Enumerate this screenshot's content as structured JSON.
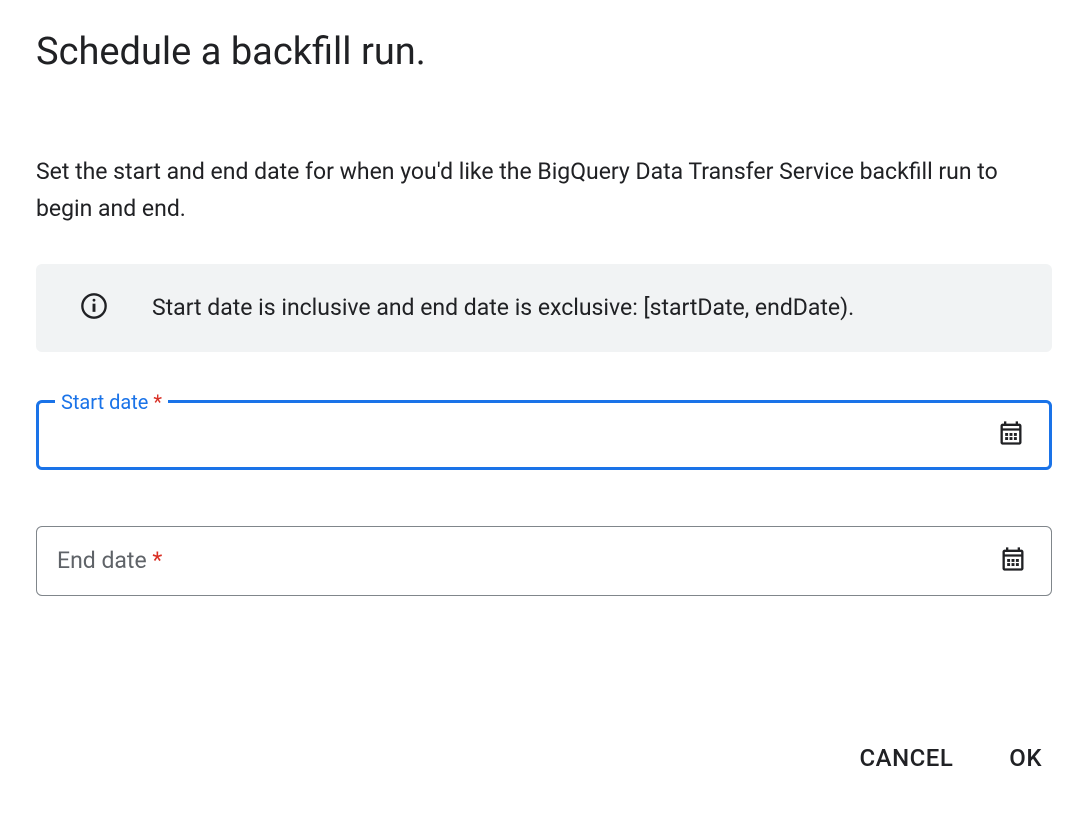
{
  "dialog": {
    "title": "Schedule a backfill run.",
    "description": "Set the start and end date for when you'd like the BigQuery Data Transfer Service backfill run to begin and end.",
    "info_banner": {
      "text": "Start date is inclusive and end date is exclusive: [startDate, endDate)."
    },
    "fields": {
      "start_date": {
        "label": "Start date",
        "required_mark": "*",
        "value": ""
      },
      "end_date": {
        "label": "End date",
        "required_mark": "*",
        "value": ""
      }
    },
    "actions": {
      "cancel": "CANCEL",
      "ok": "OK"
    }
  }
}
